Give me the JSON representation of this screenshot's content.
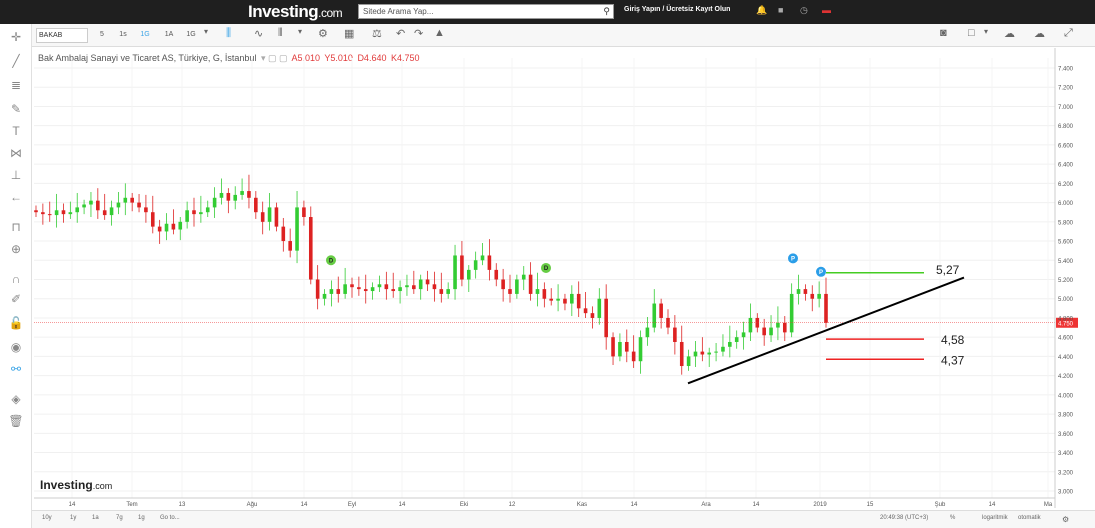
{
  "header": {
    "logo": "Investing",
    "logo_suffix": ".com",
    "search_placeholder": "Sitede Arama Yap...",
    "login": "Giriş Yapın / Ücretsiz Kayıt Olun"
  },
  "toolbar": {
    "symbol": "BAKAB",
    "intervals": [
      "5",
      "1s",
      "1G",
      "1A",
      "1G"
    ],
    "active_interval": "1G"
  },
  "chart_title": {
    "name": "Bak Ambalaj Sanayi ve Ticaret AS, Türkiye, G, İstanbul",
    "open": "A5.010",
    "high": "Y5.010",
    "low": "D4.640",
    "close": "K4.750"
  },
  "footer": {
    "ranges": [
      "10y",
      "1y",
      "1a",
      "7g",
      "1g",
      "Go to..."
    ],
    "time": "20:49:38 (UTC+3)",
    "pct": "%",
    "log": "logaritmik",
    "auto": "otomatik"
  },
  "watermark": {
    "logo": "Investing",
    "suffix": ".com"
  },
  "colors": {
    "up": "#33cc33",
    "down": "#dd2222",
    "trend": "#000000",
    "resistance": "#44cc22",
    "support": "#ee2222",
    "price_line": "#ee3333"
  },
  "chart_data": {
    "type": "candlestick",
    "title": "Bak Ambalaj Sanayi ve Ticaret AS, Türkiye, G, İstanbul",
    "y_ticks": [
      "7.400",
      "7.200",
      "7.000",
      "6.800",
      "6.600",
      "6.400",
      "6.200",
      "6.000",
      "5.800",
      "5.600",
      "5.400",
      "5.200",
      "5.000",
      "4.800",
      "4.600",
      "4.400",
      "4.200",
      "4.000",
      "3.800",
      "3.600",
      "3.400",
      "3.200",
      "3.000"
    ],
    "ylim": [
      3.0,
      7.4
    ],
    "x_labels": [
      "14",
      "Tem",
      "13",
      "Ağu",
      "14",
      "Eyl",
      "14",
      "Eki",
      "12",
      "Kas",
      "14",
      "Ara",
      "14",
      "2019",
      "15",
      "Şub",
      "14",
      "Ma"
    ],
    "last_price": "4.750",
    "closes": [
      5.9,
      5.88,
      5.87,
      5.92,
      5.88,
      5.9,
      5.95,
      5.98,
      6.02,
      5.92,
      5.87,
      5.95,
      6.0,
      6.05,
      6.0,
      5.95,
      5.9,
      5.75,
      5.7,
      5.78,
      5.72,
      5.8,
      5.92,
      5.88,
      5.9,
      5.95,
      6.05,
      6.1,
      6.02,
      6.08,
      6.12,
      6.05,
      5.9,
      5.8,
      5.95,
      5.75,
      5.6,
      5.5,
      5.95,
      5.85,
      5.2,
      5.0,
      5.05,
      5.1,
      5.05,
      5.15,
      5.12,
      5.1,
      5.08,
      5.12,
      5.15,
      5.1,
      5.08,
      5.12,
      5.14,
      5.1,
      5.2,
      5.15,
      5.1,
      5.05,
      5.1,
      5.45,
      5.2,
      5.3,
      5.4,
      5.45,
      5.3,
      5.2,
      5.1,
      5.05,
      5.2,
      5.25,
      5.05,
      5.1,
      5.0,
      4.98,
      5.0,
      4.95,
      5.05,
      4.9,
      4.85,
      4.8,
      5.0,
      4.6,
      4.4,
      4.55,
      4.45,
      4.35,
      4.6,
      4.7,
      4.95,
      4.8,
      4.7,
      4.55,
      4.3,
      4.4,
      4.45,
      4.42,
      4.44,
      4.45,
      4.5,
      4.55,
      4.6,
      4.65,
      4.8,
      4.7,
      4.62,
      4.7,
      4.75,
      4.65,
      5.05,
      5.1,
      5.05,
      5.0,
      5.05,
      4.75
    ],
    "annotations": {
      "resistance": {
        "value": 5.27,
        "label": "5,27"
      },
      "support1": {
        "value": 4.58,
        "label": "4,58"
      },
      "support2": {
        "value": 4.37,
        "label": "4,37"
      },
      "trendline": {
        "from": 4.12,
        "to": 5.22
      },
      "markers": [
        {
          "type": "D",
          "price": 5.4
        },
        {
          "type": "D",
          "price": 5.32
        },
        {
          "type": "P",
          "price": 5.42
        },
        {
          "type": "P",
          "price": 5.28
        }
      ]
    }
  }
}
